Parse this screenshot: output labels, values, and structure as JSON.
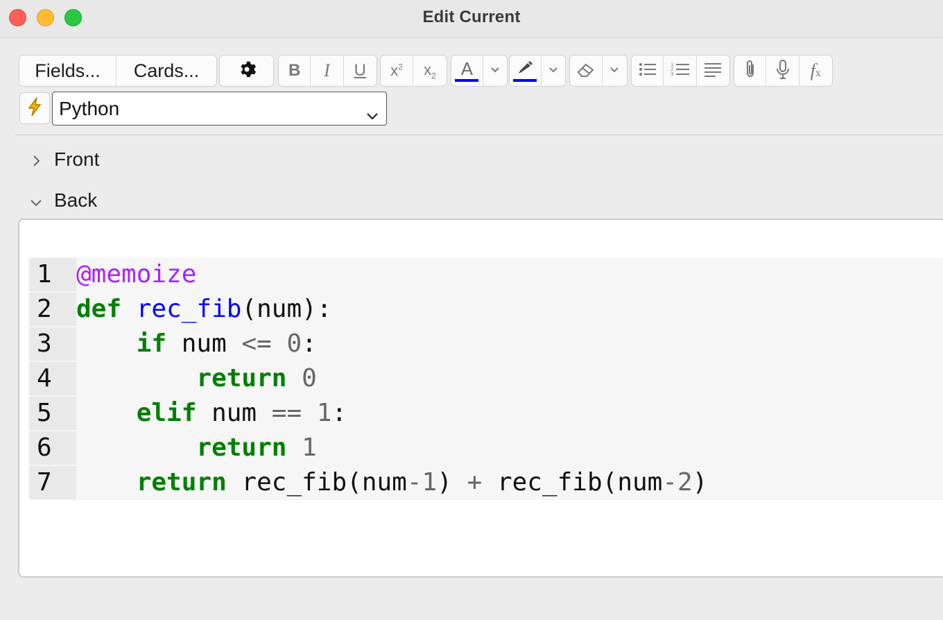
{
  "window": {
    "title": "Edit Current"
  },
  "toolbar": {
    "fields_label": "Fields...",
    "cards_label": "Cards...",
    "icons": [
      "gear-icon",
      "bold-icon",
      "italic-icon",
      "underline-icon",
      "superscript-icon",
      "subscript-icon",
      "text-color-icon",
      "highlight-icon",
      "eraser-icon",
      "bullet-list-icon",
      "numbered-list-icon",
      "align-icon",
      "attach-icon",
      "microphone-icon",
      "function-icon"
    ],
    "text_color": "#0000ff",
    "highlight_color": "#0000ff"
  },
  "notetype": {
    "selected": "Python"
  },
  "fields": [
    {
      "label": "Front",
      "expanded": false
    },
    {
      "label": "Back",
      "expanded": true
    }
  ],
  "code": {
    "lines": [
      {
        "n": "1",
        "parts": [
          {
            "t": "@memoize",
            "c": "dec"
          }
        ]
      },
      {
        "n": "2",
        "parts": [
          {
            "t": "def",
            "c": "kw"
          },
          {
            "t": " ",
            "c": "txt"
          },
          {
            "t": "rec_fib",
            "c": "fn"
          },
          {
            "t": "(num):",
            "c": "txt"
          }
        ]
      },
      {
        "n": "3",
        "parts": [
          {
            "t": "    ",
            "c": "txt"
          },
          {
            "t": "if",
            "c": "kw"
          },
          {
            "t": " num ",
            "c": "txt"
          },
          {
            "t": "<=",
            "c": "op"
          },
          {
            "t": " ",
            "c": "txt"
          },
          {
            "t": "0",
            "c": "num"
          },
          {
            "t": ":",
            "c": "txt"
          }
        ]
      },
      {
        "n": "4",
        "parts": [
          {
            "t": "        ",
            "c": "txt"
          },
          {
            "t": "return",
            "c": "kw"
          },
          {
            "t": " ",
            "c": "txt"
          },
          {
            "t": "0",
            "c": "num"
          }
        ]
      },
      {
        "n": "5",
        "parts": [
          {
            "t": "    ",
            "c": "txt"
          },
          {
            "t": "elif",
            "c": "kw"
          },
          {
            "t": " num ",
            "c": "txt"
          },
          {
            "t": "==",
            "c": "op"
          },
          {
            "t": " ",
            "c": "txt"
          },
          {
            "t": "1",
            "c": "num"
          },
          {
            "t": ":",
            "c": "txt"
          }
        ]
      },
      {
        "n": "6",
        "parts": [
          {
            "t": "        ",
            "c": "txt"
          },
          {
            "t": "return",
            "c": "kw"
          },
          {
            "t": " ",
            "c": "txt"
          },
          {
            "t": "1",
            "c": "num"
          }
        ]
      },
      {
        "n": "7",
        "parts": [
          {
            "t": "    ",
            "c": "txt"
          },
          {
            "t": "return",
            "c": "kw"
          },
          {
            "t": " rec_fib(num",
            "c": "txt"
          },
          {
            "t": "-",
            "c": "op"
          },
          {
            "t": "1",
            "c": "num"
          },
          {
            "t": ") ",
            "c": "txt"
          },
          {
            "t": "+",
            "c": "op"
          },
          {
            "t": " rec_fib(num",
            "c": "txt"
          },
          {
            "t": "-",
            "c": "op"
          },
          {
            "t": "2",
            "c": "num"
          },
          {
            "t": ")",
            "c": "txt"
          }
        ]
      }
    ]
  }
}
